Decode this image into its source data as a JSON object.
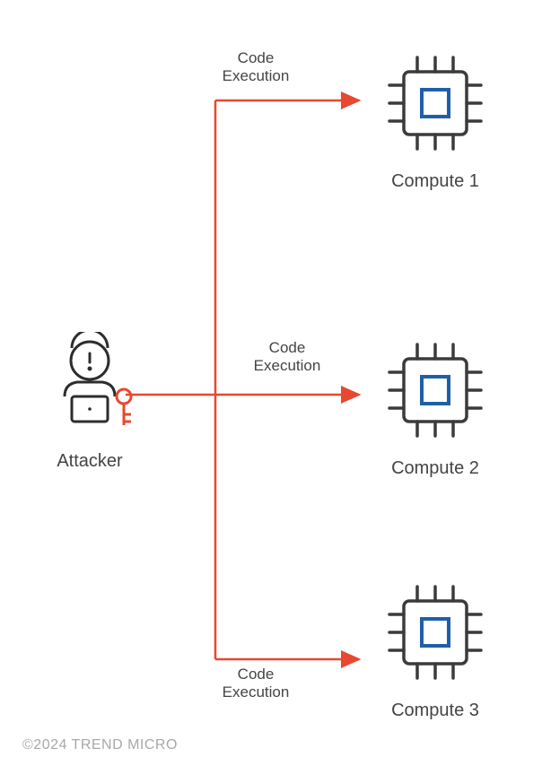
{
  "diagram": {
    "attacker": {
      "label": "Attacker"
    },
    "nodes": [
      {
        "label": "Compute 1",
        "edge_label": "Code\nExecution"
      },
      {
        "label": "Compute 2",
        "edge_label": "Code\nExecution"
      },
      {
        "label": "Compute 3",
        "edge_label": "Code\nExecution"
      }
    ],
    "colors": {
      "arrow": "#e8482f",
      "cpu_outline": "#3b3b3b",
      "cpu_core": "#1f5fa8",
      "attacker_outline": "#2d2d2d",
      "key": "#e8482f"
    }
  },
  "copyright": "©2024 TREND MICRO"
}
